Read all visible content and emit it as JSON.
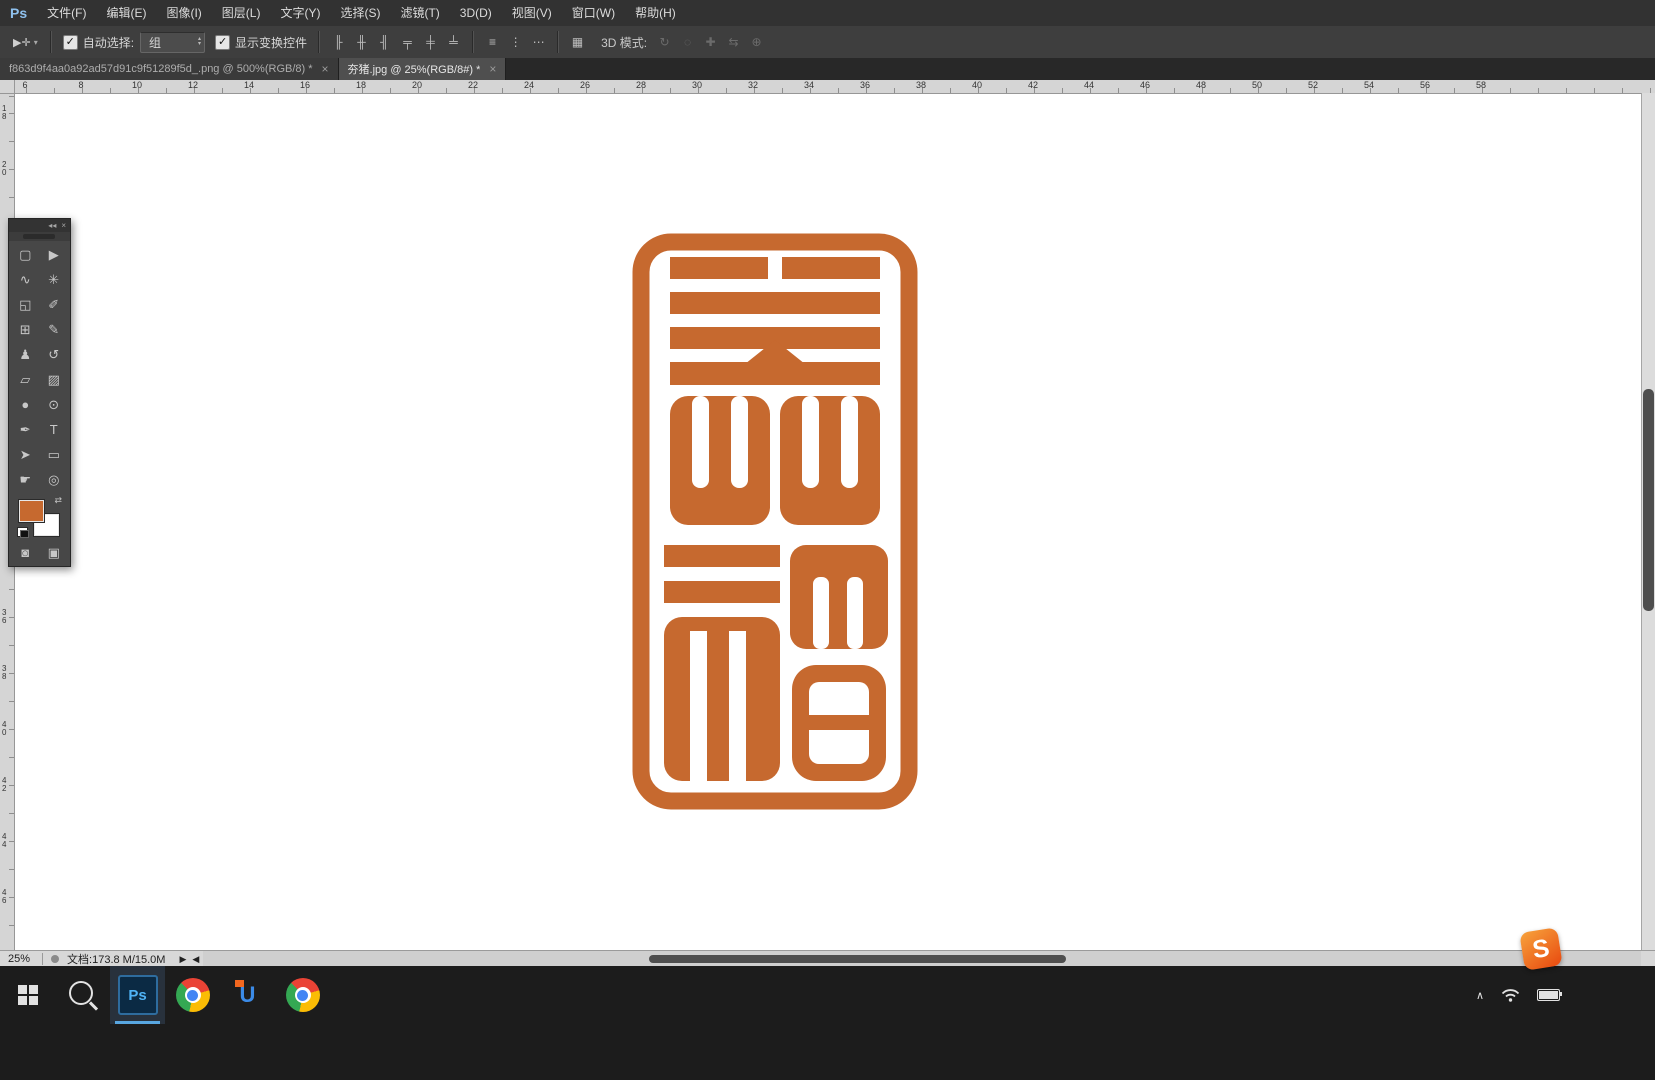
{
  "app": {
    "logo_text": "Ps"
  },
  "menu_bar": {
    "items": [
      "文件(F)",
      "编辑(E)",
      "图像(I)",
      "图层(L)",
      "文字(Y)",
      "选择(S)",
      "滤镜(T)",
      "3D(D)",
      "视图(V)",
      "窗口(W)",
      "帮助(H)"
    ]
  },
  "options_bar": {
    "tool_icon_glyph": "▶✛",
    "caret_glyph": "▾",
    "check_glyph": "✓",
    "auto_select_label": "自动选择:",
    "auto_select_value": "组",
    "spinner_up_glyph": "▴",
    "spinner_down_glyph": "▾",
    "show_transform_label": "显示变换控件",
    "align_icons": [
      {
        "name": "align-left-edges-icon",
        "glyph": "╟"
      },
      {
        "name": "align-horizontal-centers-icon",
        "glyph": "╫"
      },
      {
        "name": "align-right-edges-icon",
        "glyph": "╢"
      },
      {
        "name": "align-top-edges-icon",
        "glyph": "╤"
      },
      {
        "name": "align-vertical-centers-icon",
        "glyph": "╪"
      },
      {
        "name": "align-bottom-edges-icon",
        "glyph": "╧"
      }
    ],
    "distribute_icons": [
      {
        "name": "distribute-vertical-icon",
        "glyph": "≡"
      },
      {
        "name": "distribute-horizontal-icon",
        "glyph": "⋮"
      },
      {
        "name": "distribute-evenly-icon",
        "glyph": "⋯"
      }
    ],
    "auto_align_icon": {
      "name": "auto-align-layers-icon",
      "glyph": "▦"
    },
    "mode_3d_label": "3D 模式:",
    "mode_3d_icons": [
      {
        "name": "3d-rotate-icon",
        "glyph": "↻"
      },
      {
        "name": "3d-roll-icon",
        "glyph": "◌"
      },
      {
        "name": "3d-pan-icon",
        "glyph": "✚"
      },
      {
        "name": "3d-slide-icon",
        "glyph": "⇆"
      },
      {
        "name": "3d-zoom-icon",
        "glyph": "⊕"
      }
    ]
  },
  "document_tabs": [
    {
      "title": "f863d9f4aa0a92ad57d91c9f51289f5d_.png @ 500%(RGB/8) *",
      "close_glyph": "×",
      "active": false
    },
    {
      "title": "夯猪.jpg @ 25%(RGB/8#) *",
      "close_glyph": "×",
      "active": true
    }
  ],
  "rulers": {
    "horizontal_labels": [
      6,
      8,
      10,
      12,
      14,
      16,
      18,
      20,
      22,
      24,
      26,
      28,
      30,
      32,
      34,
      36,
      38,
      40,
      42,
      44,
      46,
      48,
      50,
      52,
      54,
      56,
      58
    ],
    "vertical_labels": [
      18,
      20,
      36,
      38,
      40,
      42,
      44,
      46
    ]
  },
  "tool_palette": {
    "collapse_glyph": "◂◂",
    "close_glyph": "×",
    "swap_glyph": "⇄",
    "foreground_color": "#C6692F",
    "background_color": "#FFFFFF",
    "tools": [
      {
        "name": "rectangular-marquee-tool",
        "glyph": "▢"
      },
      {
        "name": "move-tool",
        "glyph": "▶"
      },
      {
        "name": "lasso-tool",
        "glyph": "∿"
      },
      {
        "name": "magic-wand-tool",
        "glyph": "✳"
      },
      {
        "name": "crop-tool",
        "glyph": "◱"
      },
      {
        "name": "eyedropper-tool",
        "glyph": "✐"
      },
      {
        "name": "spot-healing-brush-tool",
        "glyph": "⊞"
      },
      {
        "name": "brush-tool",
        "glyph": "✎"
      },
      {
        "name": "clone-stamp-tool",
        "glyph": "♟"
      },
      {
        "name": "history-brush-tool",
        "glyph": "↺"
      },
      {
        "name": "eraser-tool",
        "glyph": "▱"
      },
      {
        "name": "gradient-tool",
        "glyph": "▨"
      },
      {
        "name": "blur-tool",
        "glyph": "●"
      },
      {
        "name": "dodge-tool",
        "glyph": "⊙"
      },
      {
        "name": "pen-tool",
        "glyph": "✒"
      },
      {
        "name": "type-tool",
        "glyph": "T"
      },
      {
        "name": "path-selection-tool",
        "glyph": "➤"
      },
      {
        "name": "rectangle-tool",
        "glyph": "▭"
      },
      {
        "name": "hand-tool",
        "glyph": "☛"
      },
      {
        "name": "zoom-tool",
        "glyph": "◎"
      }
    ],
    "extra_tools": [
      {
        "name": "quick-mask-icon",
        "glyph": "◙"
      },
      {
        "name": "screen-mode-icon",
        "glyph": "▣"
      }
    ]
  },
  "canvas": {
    "artwork_color": "#C6692F",
    "background_color": "#FFFFFF"
  },
  "status_bar": {
    "zoom": "25%",
    "document_info": "文档:173.8 M/15.0M",
    "play_glyph": "▶",
    "scroll_left_glyph": "◀"
  },
  "taskbar": {
    "ps_label": "Ps",
    "u_app_letter": "U",
    "tray_expand_glyph": "∧"
  },
  "watermark": {
    "letter": "S",
    "color": "#E8490F"
  }
}
